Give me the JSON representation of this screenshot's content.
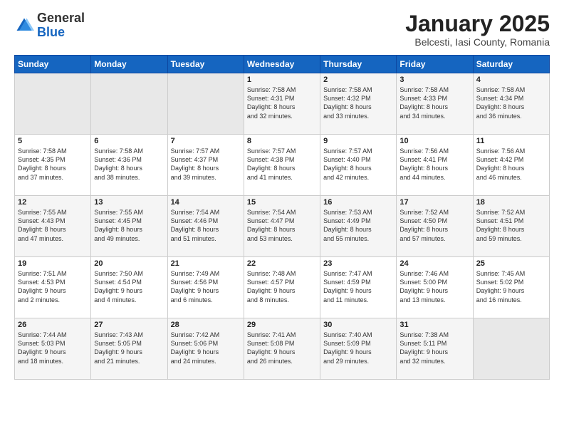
{
  "header": {
    "logo_general": "General",
    "logo_blue": "Blue",
    "title": "January 2025",
    "subtitle": "Belcesti, Iasi County, Romania"
  },
  "weekdays": [
    "Sunday",
    "Monday",
    "Tuesday",
    "Wednesday",
    "Thursday",
    "Friday",
    "Saturday"
  ],
  "weeks": [
    [
      {
        "day": "",
        "sunrise": "",
        "sunset": "",
        "daylight": "",
        "empty": true
      },
      {
        "day": "",
        "sunrise": "",
        "sunset": "",
        "daylight": "",
        "empty": true
      },
      {
        "day": "",
        "sunrise": "",
        "sunset": "",
        "daylight": "",
        "empty": true
      },
      {
        "day": "1",
        "sunrise": "7:58 AM",
        "sunset": "4:31 PM",
        "daylight": "8 hours and 32 minutes."
      },
      {
        "day": "2",
        "sunrise": "7:58 AM",
        "sunset": "4:32 PM",
        "daylight": "8 hours and 33 minutes."
      },
      {
        "day": "3",
        "sunrise": "7:58 AM",
        "sunset": "4:33 PM",
        "daylight": "8 hours and 34 minutes."
      },
      {
        "day": "4",
        "sunrise": "7:58 AM",
        "sunset": "4:34 PM",
        "daylight": "8 hours and 36 minutes."
      }
    ],
    [
      {
        "day": "5",
        "sunrise": "7:58 AM",
        "sunset": "4:35 PM",
        "daylight": "8 hours and 37 minutes."
      },
      {
        "day": "6",
        "sunrise": "7:58 AM",
        "sunset": "4:36 PM",
        "daylight": "8 hours and 38 minutes."
      },
      {
        "day": "7",
        "sunrise": "7:57 AM",
        "sunset": "4:37 PM",
        "daylight": "8 hours and 39 minutes."
      },
      {
        "day": "8",
        "sunrise": "7:57 AM",
        "sunset": "4:38 PM",
        "daylight": "8 hours and 41 minutes."
      },
      {
        "day": "9",
        "sunrise": "7:57 AM",
        "sunset": "4:40 PM",
        "daylight": "8 hours and 42 minutes."
      },
      {
        "day": "10",
        "sunrise": "7:56 AM",
        "sunset": "4:41 PM",
        "daylight": "8 hours and 44 minutes."
      },
      {
        "day": "11",
        "sunrise": "7:56 AM",
        "sunset": "4:42 PM",
        "daylight": "8 hours and 46 minutes."
      }
    ],
    [
      {
        "day": "12",
        "sunrise": "7:55 AM",
        "sunset": "4:43 PM",
        "daylight": "8 hours and 47 minutes."
      },
      {
        "day": "13",
        "sunrise": "7:55 AM",
        "sunset": "4:45 PM",
        "daylight": "8 hours and 49 minutes."
      },
      {
        "day": "14",
        "sunrise": "7:54 AM",
        "sunset": "4:46 PM",
        "daylight": "8 hours and 51 minutes."
      },
      {
        "day": "15",
        "sunrise": "7:54 AM",
        "sunset": "4:47 PM",
        "daylight": "8 hours and 53 minutes."
      },
      {
        "day": "16",
        "sunrise": "7:53 AM",
        "sunset": "4:49 PM",
        "daylight": "8 hours and 55 minutes."
      },
      {
        "day": "17",
        "sunrise": "7:52 AM",
        "sunset": "4:50 PM",
        "daylight": "8 hours and 57 minutes."
      },
      {
        "day": "18",
        "sunrise": "7:52 AM",
        "sunset": "4:51 PM",
        "daylight": "8 hours and 59 minutes."
      }
    ],
    [
      {
        "day": "19",
        "sunrise": "7:51 AM",
        "sunset": "4:53 PM",
        "daylight": "9 hours and 2 minutes."
      },
      {
        "day": "20",
        "sunrise": "7:50 AM",
        "sunset": "4:54 PM",
        "daylight": "9 hours and 4 minutes."
      },
      {
        "day": "21",
        "sunrise": "7:49 AM",
        "sunset": "4:56 PM",
        "daylight": "9 hours and 6 minutes."
      },
      {
        "day": "22",
        "sunrise": "7:48 AM",
        "sunset": "4:57 PM",
        "daylight": "9 hours and 8 minutes."
      },
      {
        "day": "23",
        "sunrise": "7:47 AM",
        "sunset": "4:59 PM",
        "daylight": "9 hours and 11 minutes."
      },
      {
        "day": "24",
        "sunrise": "7:46 AM",
        "sunset": "5:00 PM",
        "daylight": "9 hours and 13 minutes."
      },
      {
        "day": "25",
        "sunrise": "7:45 AM",
        "sunset": "5:02 PM",
        "daylight": "9 hours and 16 minutes."
      }
    ],
    [
      {
        "day": "26",
        "sunrise": "7:44 AM",
        "sunset": "5:03 PM",
        "daylight": "9 hours and 18 minutes."
      },
      {
        "day": "27",
        "sunrise": "7:43 AM",
        "sunset": "5:05 PM",
        "daylight": "9 hours and 21 minutes."
      },
      {
        "day": "28",
        "sunrise": "7:42 AM",
        "sunset": "5:06 PM",
        "daylight": "9 hours and 24 minutes."
      },
      {
        "day": "29",
        "sunrise": "7:41 AM",
        "sunset": "5:08 PM",
        "daylight": "9 hours and 26 minutes."
      },
      {
        "day": "30",
        "sunrise": "7:40 AM",
        "sunset": "5:09 PM",
        "daylight": "9 hours and 29 minutes."
      },
      {
        "day": "31",
        "sunrise": "7:38 AM",
        "sunset": "5:11 PM",
        "daylight": "9 hours and 32 minutes."
      },
      {
        "day": "",
        "sunrise": "",
        "sunset": "",
        "daylight": "",
        "empty": true
      }
    ]
  ]
}
